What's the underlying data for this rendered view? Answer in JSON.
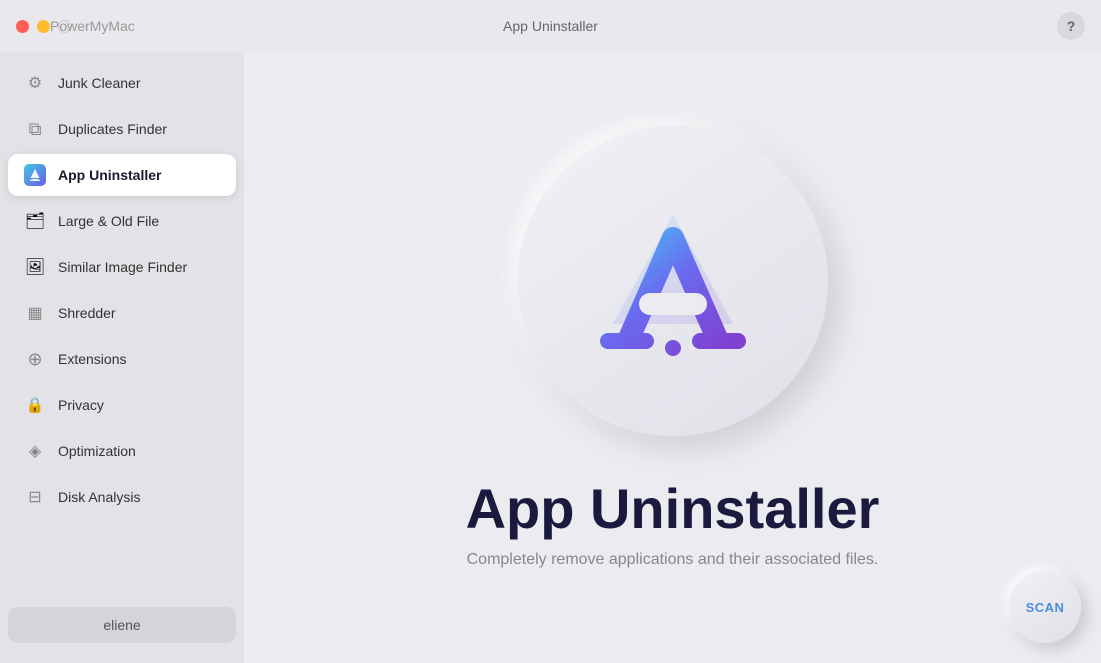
{
  "titlebar": {
    "app_name": "PowerMyMac",
    "center_title": "App Uninstaller",
    "help_label": "?"
  },
  "sidebar": {
    "items": [
      {
        "id": "junk-cleaner",
        "label": "Junk Cleaner",
        "icon": "gear"
      },
      {
        "id": "duplicates-finder",
        "label": "Duplicates Finder",
        "icon": "duplicate"
      },
      {
        "id": "app-uninstaller",
        "label": "App Uninstaller",
        "icon": "app",
        "active": true
      },
      {
        "id": "large-old-file",
        "label": "Large & Old File",
        "icon": "large"
      },
      {
        "id": "similar-image-finder",
        "label": "Similar Image Finder",
        "icon": "image"
      },
      {
        "id": "shredder",
        "label": "Shredder",
        "icon": "shred"
      },
      {
        "id": "extensions",
        "label": "Extensions",
        "icon": "ext"
      },
      {
        "id": "privacy",
        "label": "Privacy",
        "icon": "privacy"
      },
      {
        "id": "optimization",
        "label": "Optimization",
        "icon": "optim"
      },
      {
        "id": "disk-analysis",
        "label": "Disk Analysis",
        "icon": "disk"
      }
    ],
    "user_label": "eliene"
  },
  "content": {
    "app_title": "App Uninstaller",
    "app_description": "Completely remove applications and their associated files."
  },
  "scan_button": {
    "label": "SCAN"
  }
}
